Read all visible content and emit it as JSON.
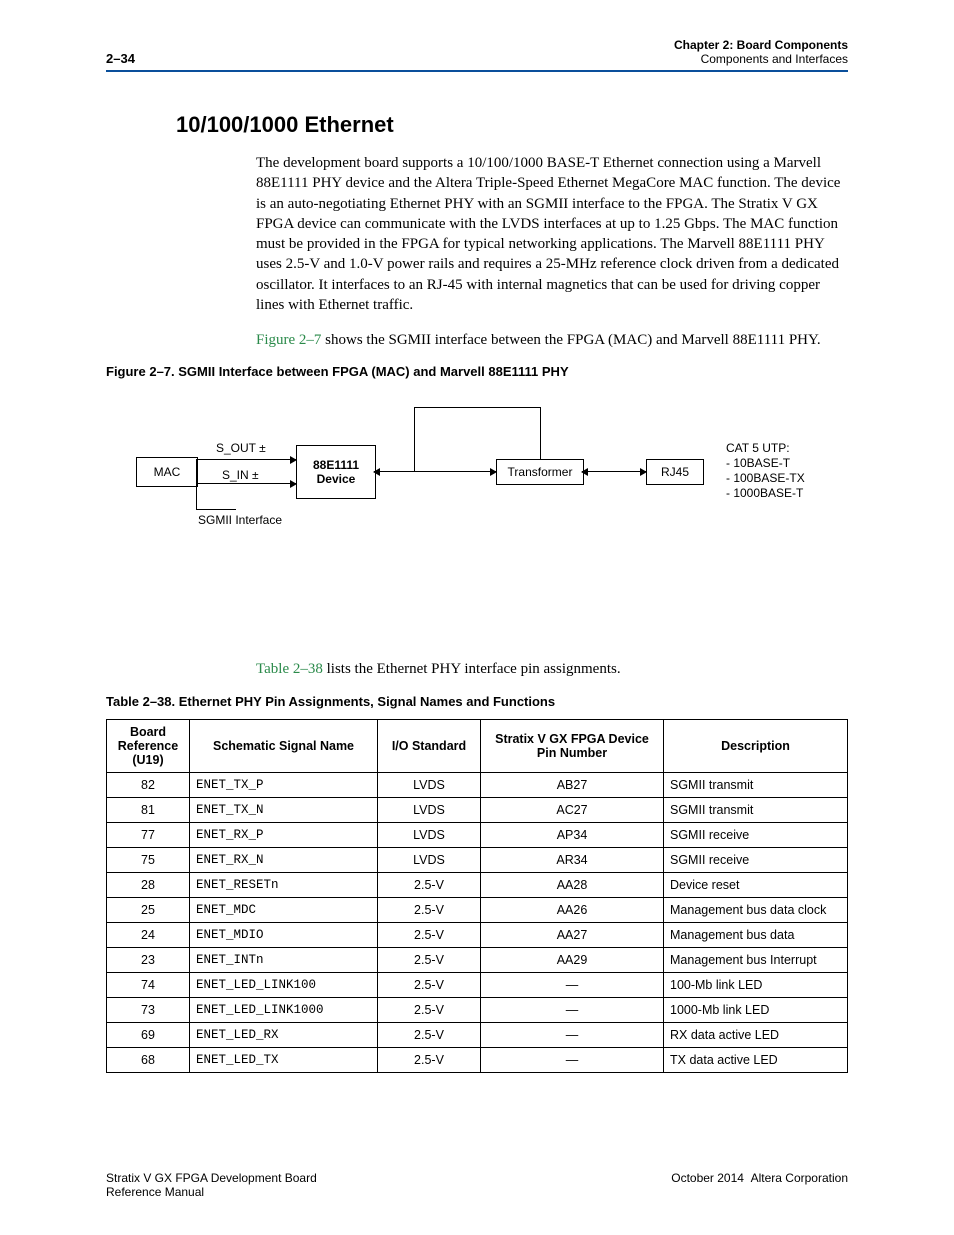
{
  "header": {
    "page_num": "2–34",
    "chapter_line": "Chapter 2: Board Components",
    "sub_line": "Components and Interfaces"
  },
  "section": {
    "title": "10/100/1000 Ethernet",
    "para1": "The development board supports a 10/100/1000 BASE-T Ethernet connection using a Marvell 88E1111 PHY device and the Altera Triple-Speed Ethernet MegaCore MAC function. The device is an auto-negotiating Ethernet PHY with an SGMII interface to the FPGA. The Stratix V GX FPGA device can communicate with the LVDS interfaces at up to 1.25 Gbps. The MAC function must be provided in the FPGA for typical networking applications. The Marvell 88E1111 PHY uses 2.5-V and 1.0-V power rails and requires a 25-MHz reference clock driven from a dedicated oscillator. It interfaces to an RJ-45 with internal magnetics that can be used for driving copper lines with Ethernet traffic.",
    "para2_ref": "Figure 2–7",
    "para2_rest": " shows the SGMII interface between the FPGA (MAC) and Marvell 88E1111 PHY."
  },
  "figure": {
    "caption": "Figure 2–7. SGMII Interface between FPGA (MAC) and Marvell 88E1111 PHY",
    "mac": "MAC",
    "s_out": "S_OUT ±",
    "s_in": "S_IN ±",
    "sgmii": "SGMII Interface",
    "device_l1": "88E1111",
    "device_l2": "Device",
    "transformer": "Transformer",
    "rj45": "RJ45",
    "cat5_l1": "CAT 5 UTP:",
    "cat5_l2": "- 10BASE-T",
    "cat5_l3": "- 100BASE-TX",
    "cat5_l4": "- 1000BASE-T"
  },
  "table_intro_ref": "Table 2–38",
  "table_intro_rest": " lists the Ethernet PHY interface pin assignments.",
  "table": {
    "caption": "Table 2–38. Ethernet PHY Pin Assignments, Signal Names and Functions",
    "headers": {
      "ref": "Board Reference (U19)",
      "sig": "Schematic Signal Name",
      "io": "I/O Standard",
      "pin": "Stratix V GX FPGA Device Pin Number",
      "desc": "Description"
    },
    "rows": [
      {
        "ref": "82",
        "sig": "ENET_TX_P",
        "io": "LVDS",
        "pin": "AB27",
        "desc": "SGMII transmit"
      },
      {
        "ref": "81",
        "sig": "ENET_TX_N",
        "io": "LVDS",
        "pin": "AC27",
        "desc": "SGMII transmit"
      },
      {
        "ref": "77",
        "sig": "ENET_RX_P",
        "io": "LVDS",
        "pin": "AP34",
        "desc": "SGMII receive"
      },
      {
        "ref": "75",
        "sig": "ENET_RX_N",
        "io": "LVDS",
        "pin": "AR34",
        "desc": "SGMII receive"
      },
      {
        "ref": "28",
        "sig": "ENET_RESETn",
        "io": "2.5-V",
        "pin": "AA28",
        "desc": "Device reset"
      },
      {
        "ref": "25",
        "sig": "ENET_MDC",
        "io": "2.5-V",
        "pin": "AA26",
        "desc": "Management bus data clock"
      },
      {
        "ref": "24",
        "sig": "ENET_MDIO",
        "io": "2.5-V",
        "pin": "AA27",
        "desc": "Management bus data"
      },
      {
        "ref": "23",
        "sig": "ENET_INTn",
        "io": "2.5-V",
        "pin": "AA29",
        "desc": "Management bus Interrupt"
      },
      {
        "ref": "74",
        "sig": "ENET_LED_LINK100",
        "io": "2.5-V",
        "pin": "—",
        "desc": "100-Mb link LED"
      },
      {
        "ref": "73",
        "sig": "ENET_LED_LINK1000",
        "io": "2.5-V",
        "pin": "—",
        "desc": "1000-Mb link LED"
      },
      {
        "ref": "69",
        "sig": "ENET_LED_RX",
        "io": "2.5-V",
        "pin": "—",
        "desc": "RX data active LED"
      },
      {
        "ref": "68",
        "sig": "ENET_LED_TX",
        "io": "2.5-V",
        "pin": "—",
        "desc": "TX data active LED"
      }
    ]
  },
  "footer": {
    "left_l1": "Stratix V GX FPGA Development Board",
    "left_l2": "Reference Manual",
    "right": "October 2014  Altera Corporation"
  }
}
